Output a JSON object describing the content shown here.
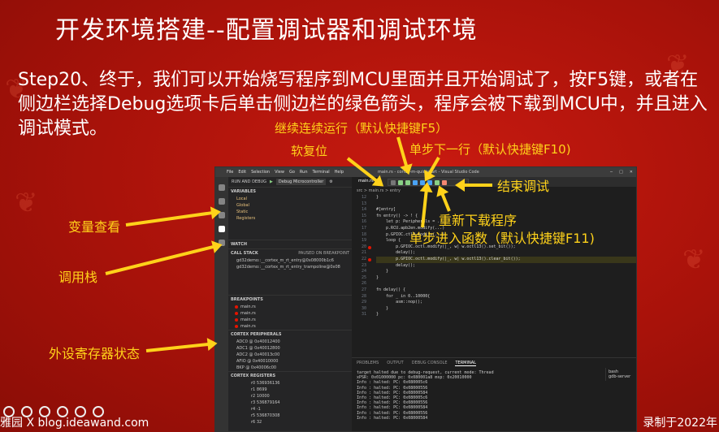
{
  "slide": {
    "title": "开发环境搭建--配置调试器和调试环境",
    "body": "Step20、终于，我们可以开始烧写程序到MCU里面并且开始调试了，按F5键，或者在侧边栏选择Debug选项卡后单击侧边栏的绿色箭头，程序会被下载到MCU中，并且进入调试模式。"
  },
  "annotations": {
    "continue": "继续连续运行（默认快捷键F5）",
    "reset": "软复位",
    "step_over": "单步下一行（默认快捷键F10)",
    "stop": "结束调试",
    "restart": "重新下载程序",
    "step_into": "单步进入函数（默认快捷键F11)",
    "variables": "变量查看",
    "callstack": "调用栈",
    "peripherals": "外设寄存器状态"
  },
  "vscode": {
    "menu": [
      "File",
      "Edit",
      "Selection",
      "View",
      "Go",
      "Run",
      "Terminal",
      "Help"
    ],
    "window_title": "main.rs - cortex-m-quickstart - Visual Studio Code",
    "run_label": "RUN AND DEBUG",
    "config": "Debug Microcontroller",
    "variables_head": "VARIABLES",
    "variables": [
      "Local",
      "Global",
      "Static",
      "Registers"
    ],
    "watch_head": "WATCH",
    "callstack_head": "CALL STACK",
    "callstack_status": "PAUSED ON BREAKPOINT",
    "callstack_rows": [
      "gd32demo::__cortex_m_rt_entry@0x08000b1c6",
      "gd32demo::__cortex_m_rt_entry_trampoline@0x08"
    ],
    "breakpoints_head": "BREAKPOINTS",
    "breakpoints": [
      "main.rs",
      "main.rs",
      "main.rs",
      "main.rs"
    ],
    "periph_head": "CORTEX PERIPHERALS",
    "peripherals": [
      "ADC0 @ 0x40012400",
      "ADC1 @ 0x40012800",
      "ADC2 @ 0x40013c00",
      "AFIO @ 0x40010000",
      "BKP @ 0x40006c00"
    ],
    "registers_head": "CORTEX REGISTERS",
    "registers": [
      "r0 536936136",
      "r1 8699",
      "r2 10000",
      "r3 536879164",
      "r4 -1",
      "r5 536870308",
      "r6 32"
    ],
    "tab": "main.rs",
    "breadcrumb": "src > main.rs > entry",
    "code": [
      {
        "ln": "12",
        "text": "}"
      },
      {
        "ln": "13",
        "text": ""
      },
      {
        "ln": "14",
        "text": "#[entry]"
      },
      {
        "ln": "15",
        "text": "fn entry() -> ! {"
      },
      {
        "ln": "16",
        "text": "    let p: Peripherals = ..."
      },
      {
        "ln": "17",
        "text": "    p.RCU.apb2en.modify(...)"
      },
      {
        "ln": "18",
        "text": "    p.GPIOC.ctl0.modify(...)"
      },
      {
        "ln": "19",
        "text": "    loop {"
      },
      {
        "ln": "20",
        "text": "        p.GPIOC.octl.modify(|_, w| w.octl13().set_bit());"
      },
      {
        "ln": "21",
        "text": "        delay();"
      },
      {
        "ln": "22",
        "text": "        p.GPIOC.octl.modify(|_, w| w.octl13().clear_bit());"
      },
      {
        "ln": "23",
        "text": "        delay();"
      },
      {
        "ln": "24",
        "text": "    }"
      },
      {
        "ln": "25",
        "text": "}"
      },
      {
        "ln": "26",
        "text": ""
      },
      {
        "ln": "27",
        "text": "fn delay() {"
      },
      {
        "ln": "28",
        "text": "    for _ in 0..10000{"
      },
      {
        "ln": "29",
        "text": "        asm::nop();"
      },
      {
        "ln": "30",
        "text": "    }"
      },
      {
        "ln": "31",
        "text": "}"
      }
    ],
    "panel_tabs": [
      "PROBLEMS",
      "OUTPUT",
      "DEBUG CONSOLE",
      "TERMINAL"
    ],
    "terminal": [
      "target halted due to debug-request, current mode: Thread",
      "xPSR: 0x01000000 pc: 0x080001a8 msp: 0x20010000",
      "Info : halted: PC: 0x080005c6",
      "Info : halted: PC: 0x08000556",
      "Info : halted: PC: 0x08000584",
      "Info : halted: PC: 0x080005c6",
      "Info : halted: PC: 0x08000556",
      "Info : halted: PC: 0x08000584",
      "Info : halted: PC: 0x08000556",
      "Info : halted: PC: 0x08000584"
    ],
    "terminal_side": [
      "bash",
      "gdb-server"
    ]
  },
  "footer": {
    "left": "雅园 X blog.ideawand.com",
    "right": "录制于2022年"
  }
}
